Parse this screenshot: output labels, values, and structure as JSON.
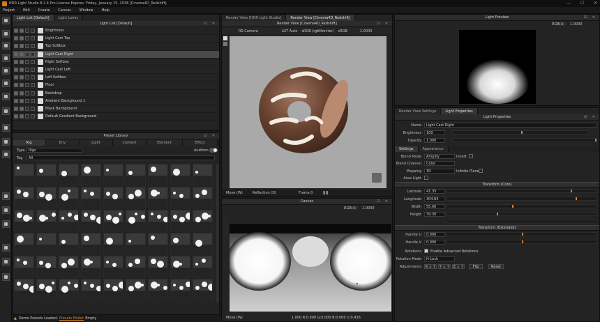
{
  "window": {
    "title": "HDR Light Studio 8.2.4  Pro License Expires: Friday, January 15, 2038  [Cinema4D_Redshift]",
    "controls": [
      "—",
      "☐",
      "✕"
    ]
  },
  "menu": [
    "Project",
    "Edit",
    "Create",
    "Canvas",
    "Window",
    "Help"
  ],
  "light_list": {
    "tabs": [
      "Light List [Default]",
      "Light Looks"
    ],
    "header": "Light List [Default]",
    "items": [
      {
        "label": "Brightness"
      },
      {
        "label": "Light Cast Top"
      },
      {
        "label": "Top Softbox"
      },
      {
        "label": "Light Cast Right",
        "selected": true
      },
      {
        "label": "Right Softbox"
      },
      {
        "label": "Light Cast Left"
      },
      {
        "label": "Left Softbox"
      },
      {
        "label": "Floor"
      },
      {
        "label": "Backdrop"
      },
      {
        "label": "Ambient Background 1"
      },
      {
        "label": "Black Background"
      },
      {
        "label": "Default Gradient Background"
      }
    ]
  },
  "preset_library": {
    "header": "Preset Library",
    "tabs": [
      "Rig",
      "Env",
      "Light",
      "Content",
      "Element",
      "Effect"
    ],
    "type_label": "Type",
    "type_value": "Rigs",
    "tag_label": "Tag",
    "tag_value": "All",
    "audition_label": "Audition"
  },
  "status": {
    "message": "Demo Presets Loaded.",
    "link": "Presets Folder",
    "suffix": "Empty"
  },
  "render_view": {
    "tabs": [
      "Render View [HDR Light Studio]",
      "Render View [Cinema4D_Redshift]"
    ],
    "header": "Render View [Cinema4D_Redshift]",
    "camera": "RS Camera",
    "lut": "LUT Auto",
    "color": "sRGB (rgbMonitor)",
    "ev": "sRGB",
    "exposure": "1.0000",
    "move_mode": "Move (W)",
    "reflection": "Reflection (D)",
    "frame": "Frame 0"
  },
  "canvas": {
    "header": "Canvas",
    "mode": "RGB(A)",
    "exposure": "1.0000",
    "move_mode": "Move (W)",
    "readout": "1.000   R:0.000 G:0.000 B:0.000 U:0.436"
  },
  "light_preview": {
    "header": "Light Preview",
    "mode": "RGB(A)",
    "exposure": "1.0000"
  },
  "light_properties": {
    "tabs": [
      "Render View Settings",
      "Light Properties"
    ],
    "header": "Light Properties",
    "name_label": "Name",
    "name_value": "Light Cast Right",
    "brightness_label": "Brightness",
    "brightness_value": "100",
    "opacity_label": "Opacity",
    "opacity_value": "1.000",
    "sub_tabs": [
      "Settings",
      "Appearance"
    ],
    "blend_mode_label": "Blend Mode",
    "blend_mode_value": "Amplify",
    "invert_label": "Invert",
    "blend_channel_label": "Blend Channel",
    "blend_channel_value": "Color",
    "mapping_label": "Mapping",
    "mapping_value": "3D",
    "infinite_plane_label": "Infinite Plane",
    "area_light_label": "Area Light",
    "transform_core": "Transform (Core)",
    "latitude_label": "Latitude",
    "latitude_value": "41.35",
    "latitude_pos": 0.82,
    "longitude_label": "Longitude",
    "longitude_value": "304.84",
    "longitude_pos": 0.85,
    "width_label": "Width",
    "width_value": "55.00",
    "width_pos": 0.43,
    "height_label": "Height",
    "height_value": "39.30",
    "height_pos": 0.33,
    "transform_extended": "Transform (Extended)",
    "handle_u_label": "Handle U",
    "handle_u_value": "0.000",
    "handle_v_label": "Handle V",
    "handle_v_value": "0.000",
    "rotations_label": "Rotations",
    "rotations_value": "Enable Advanced Rotations",
    "rotation_mode_label": "Rotation Mode",
    "rotation_mode_value": "H-Lock",
    "adjustments_label": "Adjustments",
    "adjust_buttons": [
      "X ↓ ↑",
      "Y ↓ ↑",
      "Z ↓ ↑"
    ],
    "flip_label": "Flip",
    "reset_label": "Reset"
  },
  "colors": {
    "accent": "#e07d25",
    "panel": "#232323",
    "selected": "#4a4a4a"
  }
}
